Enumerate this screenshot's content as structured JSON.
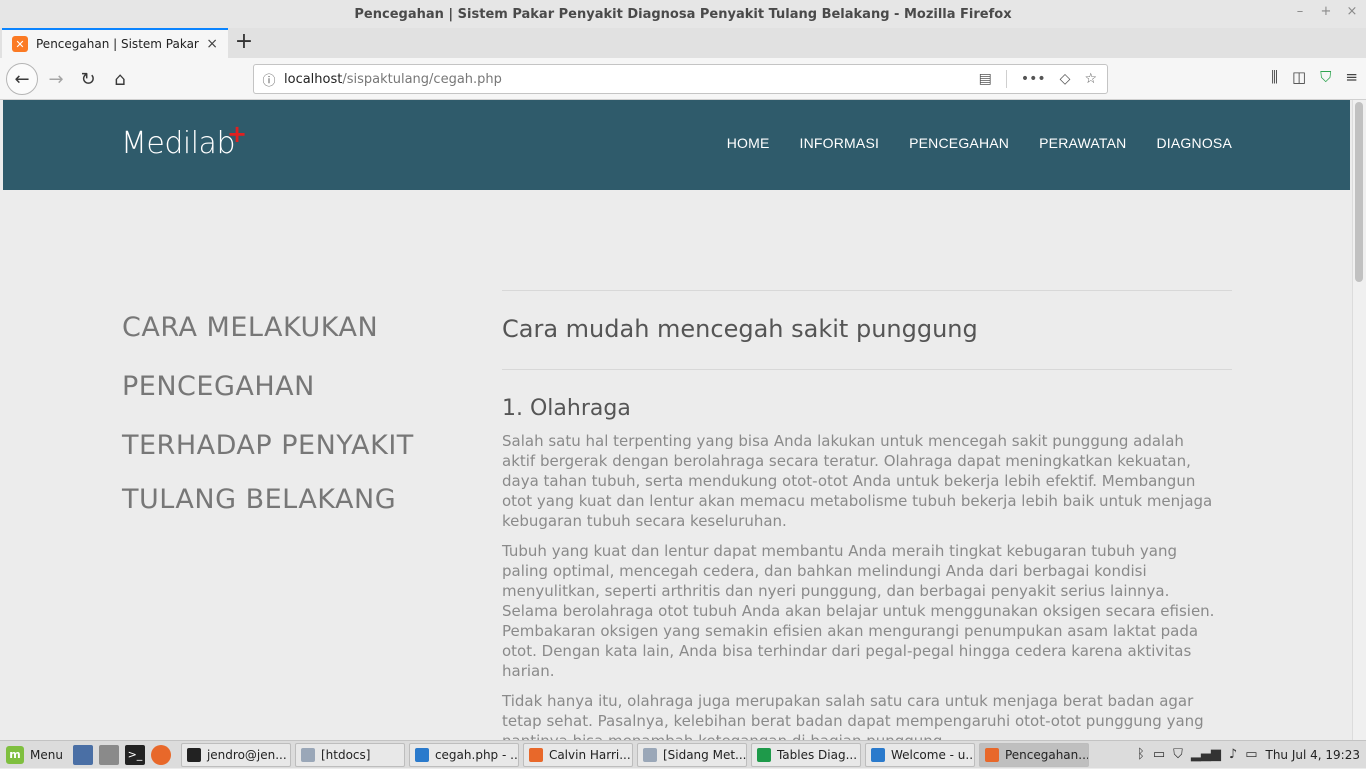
{
  "window": {
    "title": "Pencegahan | Sistem Pakar Penyakit Diagnosa Penyakit Tulang Belakang - Mozilla Firefox",
    "controls": [
      "–",
      "+",
      "×"
    ]
  },
  "tab": {
    "title": "Pencegahan | Sistem Pakar P",
    "close": "×",
    "new_tab": "+"
  },
  "nav": {
    "back": "←",
    "forward": "→",
    "reload": "↻",
    "home": "⌂",
    "url_host": "localhost",
    "url_path": "/sispaktulang/cegah.php",
    "info": "ⓘ",
    "reader": "▤",
    "more": "•••",
    "pocket": "◇",
    "star": "☆",
    "library": "⫼",
    "sidebar": "◫",
    "shield": "⛉",
    "menu": "≡"
  },
  "site": {
    "logo": "Medilab",
    "logo_plus": "+",
    "menu": [
      "HOME",
      "INFORMASI",
      "PENCEGAHAN",
      "PERAWATAN",
      "DIAGNOSA"
    ]
  },
  "content": {
    "left_heading": [
      "CARA MELAKUKAN",
      "PENCEGAHAN",
      "TERHADAP PENYAKIT",
      "TULANG BELAKANG"
    ],
    "section_title": "Cara mudah mencegah sakit punggung",
    "subsection_title": "1. Olahraga",
    "paragraphs": [
      "Salah satu hal terpenting yang bisa Anda lakukan untuk mencegah sakit punggung adalah aktif bergerak dengan berolahraga secara teratur. Olahraga dapat meningkatkan kekuatan, daya tahan tubuh, serta mendukung otot-otot Anda untuk bekerja lebih efektif. Membangun otot yang kuat dan lentur akan memacu metabolisme tubuh bekerja lebih baik untuk menjaga kebugaran tubuh secara keseluruhan.",
      "Tubuh yang kuat dan lentur dapat membantu Anda meraih tingkat kebugaran tubuh yang paling optimal, mencegah cedera, dan bahkan melindungi Anda dari berbagai kondisi menyulitkan, seperti arthritis dan nyeri punggung, dan berbagai penyakit serius lainnya. Selama berolahraga otot tubuh Anda akan belajar untuk menggunakan oksigen secara efisien. Pembakaran oksigen yang semakin efisien akan mengurangi penumpukan asam laktat pada otot. Dengan kata lain, Anda bisa terhindar dari pegal-pegal hingga cedera karena aktivitas harian.",
      "Tidak hanya itu, olahraga juga merupakan salah satu cara untuk menjaga berat badan agar tetap sehat. Pasalnya, kelebihan berat badan dapat mempengaruhi otot-otot punggung yang nantinya bisa menambah ketegangan di bagian punggung."
    ]
  },
  "taskbar": {
    "menu_label": "Menu",
    "tasks": [
      {
        "label": "jendro@jen...",
        "color": "#222222"
      },
      {
        "label": "[htdocs]",
        "color": "#9aa7b8"
      },
      {
        "label": "cegah.php - ...",
        "color": "#2a7acc"
      },
      {
        "label": "Calvin Harri...",
        "color": "#e8682a"
      },
      {
        "label": "[Sidang Met...",
        "color": "#9aa7b8"
      },
      {
        "label": "Tables Diag...",
        "color": "#1e9a4a"
      },
      {
        "label": "Welcome - u...",
        "color": "#2a7acc"
      },
      {
        "label": "Pencegahan...",
        "color": "#e8682a"
      }
    ],
    "clock": "Thu Jul  4, 19:23"
  },
  "colors": {
    "header_bg": "#2f5b6b",
    "logo_plus": "#e02020",
    "page_bg": "#ececec"
  }
}
